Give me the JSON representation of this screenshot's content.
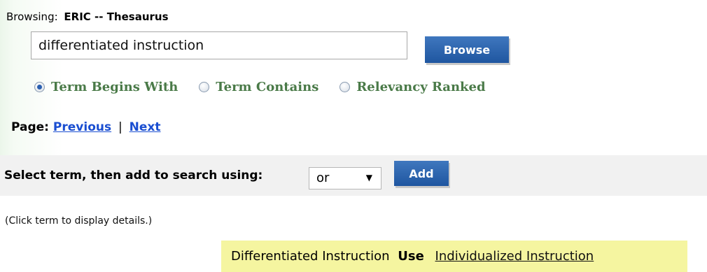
{
  "header": {
    "browsing_label": "Browsing:",
    "database_name": "ERIC -- Thesaurus"
  },
  "search": {
    "value": "differentiated instruction",
    "browse_label": "Browse"
  },
  "search_modes": [
    {
      "label": "Term Begins With",
      "selected": true
    },
    {
      "label": "Term Contains",
      "selected": false
    },
    {
      "label": "Relevancy Ranked",
      "selected": false
    }
  ],
  "pagination": {
    "label": "Page:",
    "previous": "Previous",
    "separator": "|",
    "next": "Next"
  },
  "add_bar": {
    "label": "Select term, then add to search using:",
    "operator": "or",
    "add_label": "Add"
  },
  "hint": "(Click term to display details.)",
  "result": {
    "term": "Differentiated Instruction",
    "use_label": "Use",
    "preferred_term": "Individualized Instruction"
  },
  "colors": {
    "button_blue": "#2a62ad",
    "radio_text_green": "#4a7a48",
    "result_highlight": "#f5f5a0",
    "link_blue": "#1a4ed1"
  }
}
